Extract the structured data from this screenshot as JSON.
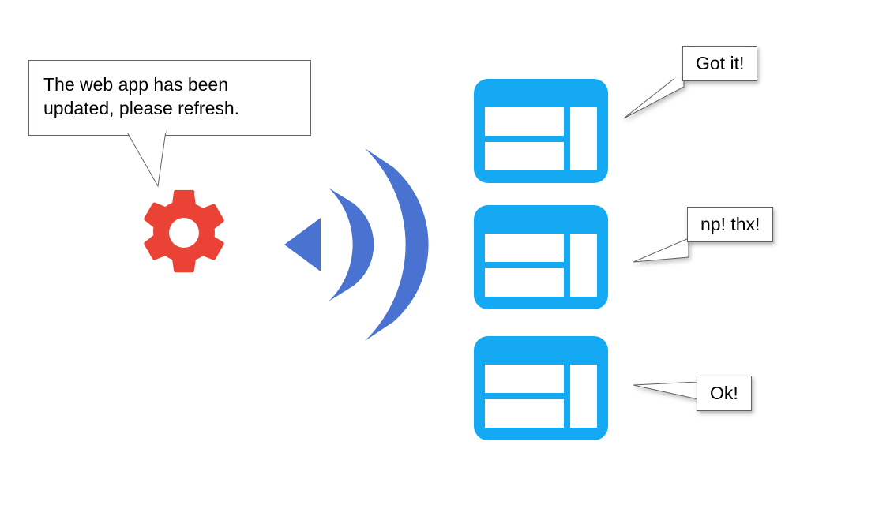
{
  "gear_message": "The web app has been updated, please refresh.",
  "replies": {
    "got_it": "Got it!",
    "np_thx": "np! thx!",
    "ok": "Ok!"
  },
  "colors": {
    "gear": "#EA4335",
    "broadcast": "#4A72D0",
    "window": "#14A9F2",
    "border": "#5f6368"
  }
}
